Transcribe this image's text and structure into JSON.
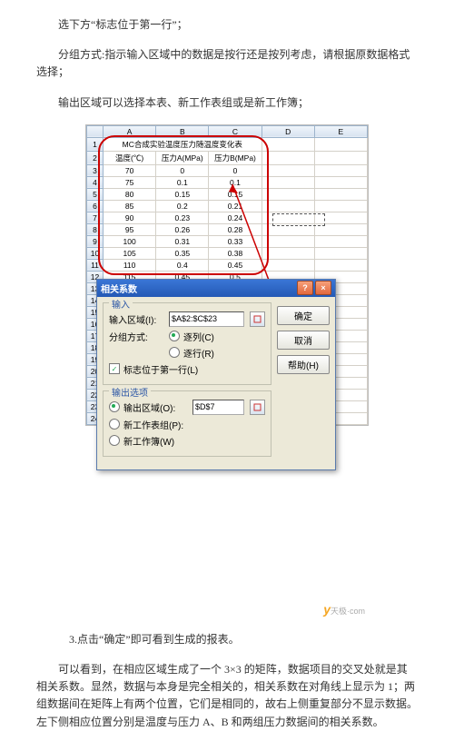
{
  "paras": {
    "p1": "选下方“标志位于第一行”；",
    "p2": "分组方式:指示输入区域中的数据是按行还是按列考虑，请根据原数据格式选择；",
    "p3": "输出区域可以选择本表、新工作表组或是新工作簿；",
    "p4": "3.点击“确定”即可看到生成的报表。",
    "p5": "可以看到，在相应区域生成了一个 3×3 的矩阵，数据项目的交叉处就是其相关系数。显然，数据与本身是完全相关的，相关系数在对角线上显示为 1；两组数据间在矩阵上有两个位置，它们是相同的，故右上侧重复部分不显示数据。左下侧相应位置分别是温度与压力 A、B 和两组压力数据间的相关系数。"
  },
  "chart_data": {
    "type": "table",
    "title": "MC合成实验温度压力随温度变化表",
    "columns": [
      "温度(℃)",
      "压力A(MPa)",
      "压力B(MPa)"
    ],
    "rows": [
      [
        "70",
        "0",
        "0"
      ],
      [
        "75",
        "0.1",
        "0.1"
      ],
      [
        "80",
        "0.15",
        "0.15"
      ],
      [
        "85",
        "0.2",
        "0.21"
      ],
      [
        "90",
        "0.23",
        "0.24"
      ],
      [
        "95",
        "0.26",
        "0.28"
      ],
      [
        "100",
        "0.31",
        "0.33"
      ],
      [
        "105",
        "0.35",
        "0.38"
      ],
      [
        "110",
        "0.4",
        "0.45"
      ],
      [
        "115",
        "0.45",
        "0.5"
      ]
    ],
    "col_letters": [
      "A",
      "B",
      "C",
      "D",
      "E"
    ]
  },
  "dialog": {
    "title": "相关系数",
    "input_group": "输入",
    "input_range_label": "输入区域(I):",
    "input_range_value": "$A$2:$C$23",
    "group_label": "分组方式:",
    "group_col": "逐列(C)",
    "group_row": "逐行(R)",
    "first_row_label": "标志位于第一行(L)",
    "output_group": "输出选项",
    "output_range_label": "输出区域(O):",
    "output_range_value": "$D$7",
    "new_sheet": "新工作表组(P):",
    "new_book": "新工作簿(W)",
    "ok": "确定",
    "cancel": "取消",
    "help": "帮助(H)"
  },
  "logo": "天极·com"
}
